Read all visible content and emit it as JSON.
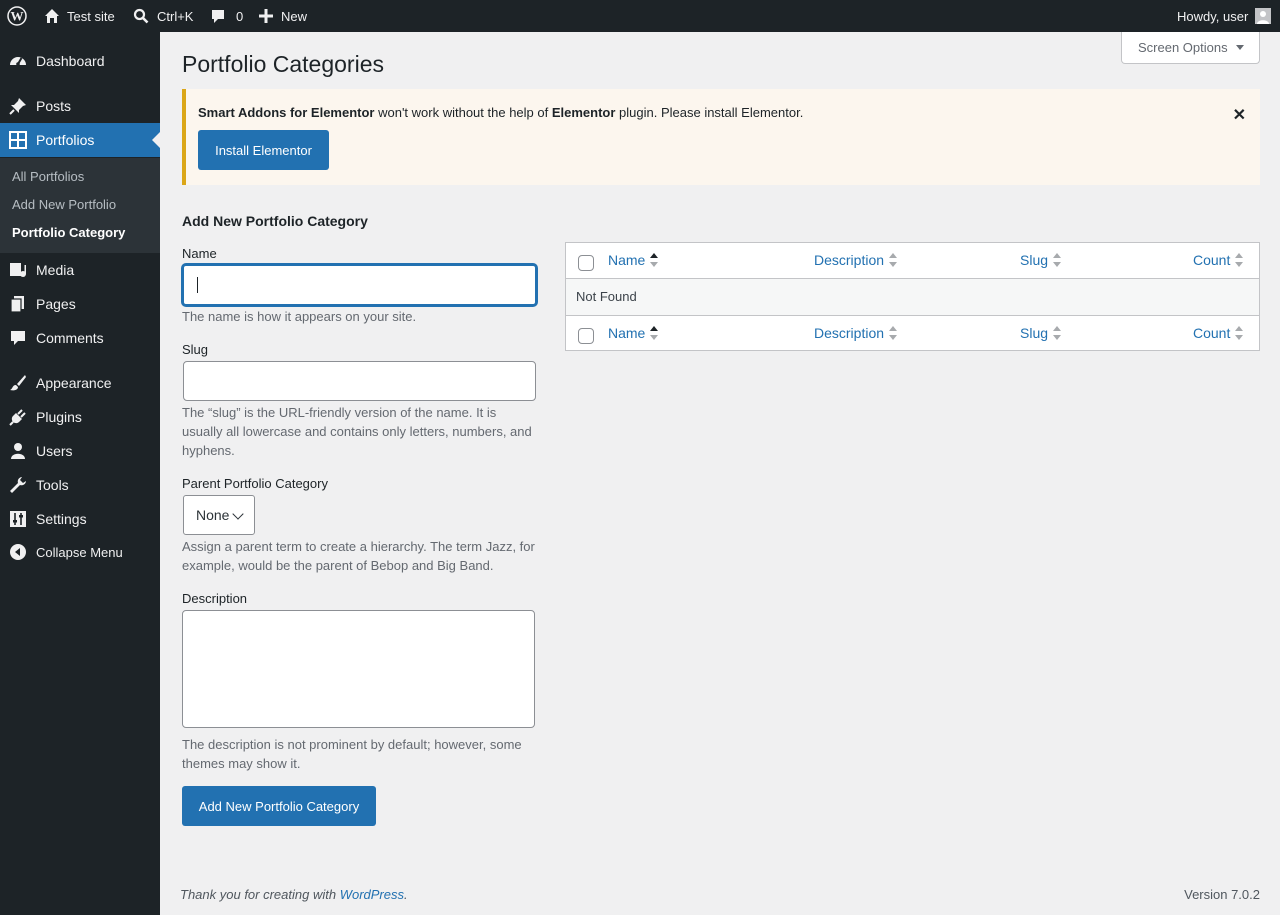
{
  "adminbar": {
    "site_name": "Test site",
    "search_shortcut": "Ctrl+K",
    "comments_count": "0",
    "new_label": "New",
    "greeting": "Howdy, user"
  },
  "sidebar": {
    "items": [
      {
        "label": "Dashboard",
        "icon": "dashboard-icon"
      },
      {
        "label": "Posts",
        "icon": "pin-icon"
      },
      {
        "label": "Portfolios",
        "icon": "grid-icon",
        "current": true
      },
      {
        "label": "Media",
        "icon": "media-icon"
      },
      {
        "label": "Pages",
        "icon": "pages-icon"
      },
      {
        "label": "Comments",
        "icon": "comment-icon"
      },
      {
        "label": "Appearance",
        "icon": "brush-icon"
      },
      {
        "label": "Plugins",
        "icon": "plug-icon"
      },
      {
        "label": "Users",
        "icon": "user-icon"
      },
      {
        "label": "Tools",
        "icon": "wrench-icon"
      },
      {
        "label": "Settings",
        "icon": "sliders-icon"
      }
    ],
    "submenu": [
      "All Portfolios",
      "Add New Portfolio",
      "Portfolio Category"
    ],
    "collapse_label": "Collapse Menu"
  },
  "screen_options": "Screen Options",
  "page_title": "Portfolio Categories",
  "notice": {
    "plugin_name": "Smart Addons for Elementor",
    "text_middle": " won't work without the help of ",
    "required_plugin": "Elementor",
    "text_end": " plugin. Please install Elementor.",
    "button_label": "Install Elementor"
  },
  "form": {
    "heading": "Add New Portfolio Category",
    "name_label": "Name",
    "name_value": "",
    "name_desc": "The name is how it appears on your site.",
    "slug_label": "Slug",
    "slug_value": "",
    "slug_desc": "The “slug” is the URL-friendly version of the name. It is usually all lowercase and contains only letters, numbers, and hyphens.",
    "parent_label": "Parent Portfolio Category",
    "parent_value": "None",
    "parent_desc": "Assign a parent term to create a hierarchy. The term Jazz, for example, would be the parent of Bebop and Big Band.",
    "description_label": "Description",
    "description_desc": "The description is not prominent by default; however, some themes may show it.",
    "submit_label": "Add New Portfolio Category"
  },
  "table": {
    "columns": [
      "Name",
      "Description",
      "Slug",
      "Count"
    ],
    "empty_text": "Not Found"
  },
  "footer": {
    "thanks_prefix": "Thank you for creating with ",
    "thanks_link": "WordPress",
    "thanks_suffix": ".",
    "version": "Version 7.0.2"
  }
}
